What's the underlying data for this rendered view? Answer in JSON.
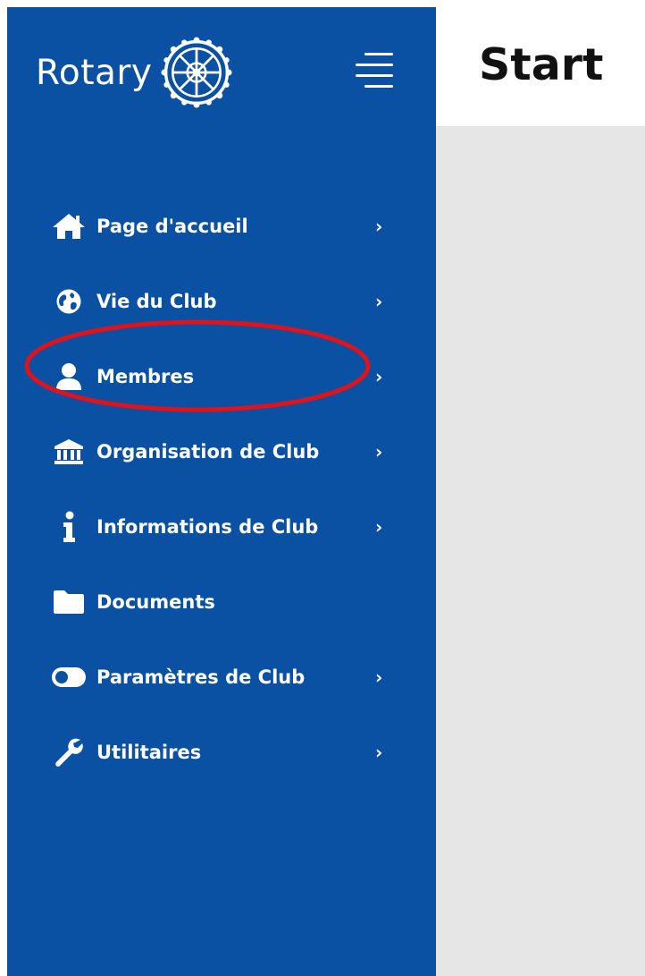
{
  "sidebar": {
    "brand": "Rotary",
    "logo_icon": "rotary-wheel-icon",
    "menu_icon": "hamburger-menu-icon",
    "items": [
      {
        "label": "Page d'accueil",
        "icon": "home-icon",
        "has_submenu": true
      },
      {
        "label": "Vie du Club",
        "icon": "globe-icon",
        "has_submenu": true
      },
      {
        "label": "Membres",
        "icon": "user-icon",
        "has_submenu": true
      },
      {
        "label": "Organisation de Club",
        "icon": "bank-icon",
        "has_submenu": true
      },
      {
        "label": "Informations de Club",
        "icon": "info-icon",
        "has_submenu": true
      },
      {
        "label": "Documents",
        "icon": "folder-icon",
        "has_submenu": false
      },
      {
        "label": "Paramètres de Club",
        "icon": "toggle-icon",
        "has_submenu": true
      },
      {
        "label": "Utilitaires",
        "icon": "wrench-icon",
        "has_submenu": true
      }
    ],
    "chevron": "›"
  },
  "header": {
    "title": "Start"
  },
  "colors": {
    "sidebar_bg": "#0a51a4",
    "content_bg": "#e6e6e6",
    "highlight": "#e0121b",
    "text_light": "#ffffff"
  },
  "annotation": {
    "highlighted_item": "Membres"
  }
}
